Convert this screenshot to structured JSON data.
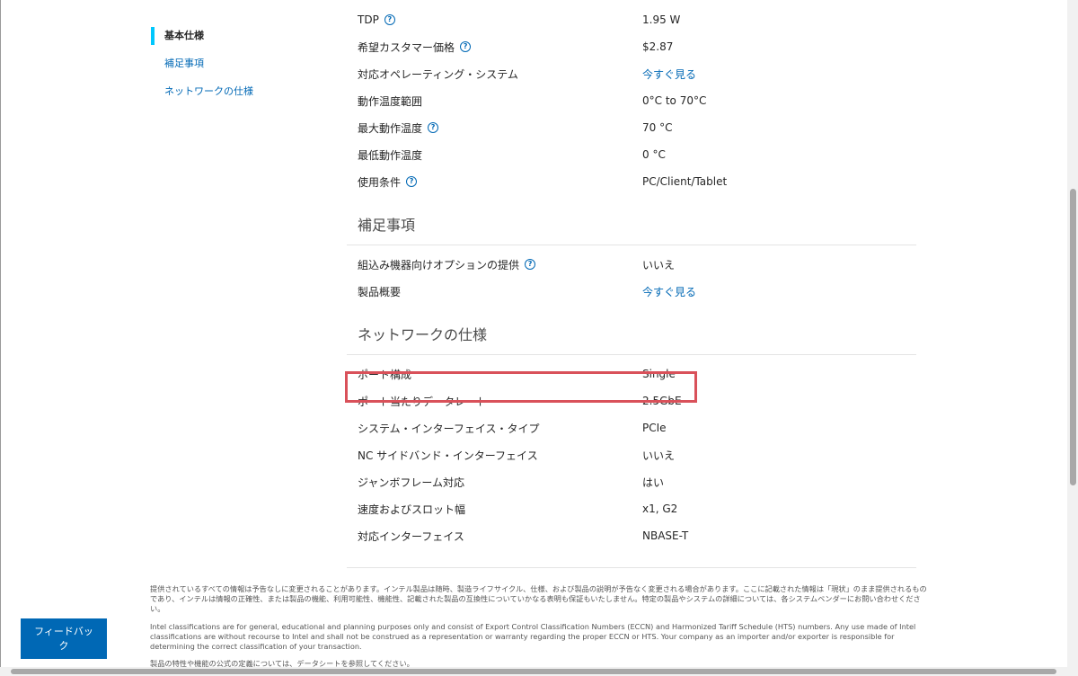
{
  "nav": {
    "items": [
      {
        "label": "基本仕様",
        "active": true
      },
      {
        "label": "補足事項",
        "active": false
      },
      {
        "label": "ネットワークの仕様",
        "active": false
      }
    ]
  },
  "essentials": {
    "rows": [
      {
        "label": "TDP",
        "value": "1.95 W",
        "help": true,
        "link": false
      },
      {
        "label": "希望カスタマー価格",
        "value": "$2.87",
        "help": true,
        "link": false
      },
      {
        "label": "対応オペレーティング・システム",
        "value": "今すぐ見る",
        "help": false,
        "link": true
      },
      {
        "label": "動作温度範囲",
        "value": "0°C to 70°C",
        "help": false,
        "link": false
      },
      {
        "label": "最大動作温度",
        "value": "70 °C",
        "help": true,
        "link": false
      },
      {
        "label": "最低動作温度",
        "value": "0 °C",
        "help": false,
        "link": false
      },
      {
        "label": "使用条件",
        "value": "PC/Client/Tablet",
        "help": true,
        "link": false
      }
    ]
  },
  "supplemental": {
    "title": "補足事項",
    "rows": [
      {
        "label": "組込み機器向けオプションの提供",
        "value": "いいえ",
        "help": true,
        "link": false
      },
      {
        "label": "製品概要",
        "value": "今すぐ見る",
        "help": false,
        "link": true
      }
    ]
  },
  "network": {
    "title": "ネットワークの仕様",
    "rows": [
      {
        "label": "ポート構成",
        "value": "Single",
        "help": false,
        "link": false
      },
      {
        "label": "ポート当たりデータレート",
        "value": "2.5GbE",
        "help": false,
        "link": false
      },
      {
        "label": "システム・インターフェイス・タイプ",
        "value": "PCIe",
        "help": false,
        "link": false
      },
      {
        "label": "NC サイドバンド・インターフェイス",
        "value": "いいえ",
        "help": false,
        "link": false
      },
      {
        "label": "ジャンボフレーム対応",
        "value": "はい",
        "help": false,
        "link": false
      },
      {
        "label": "速度およびスロット幅",
        "value": "x1, G2",
        "help": false,
        "link": false
      },
      {
        "label": "対応インターフェイス",
        "value": "NBASE-T",
        "help": false,
        "link": false
      }
    ]
  },
  "help_glyph": "?",
  "footer": {
    "disclaimer_jp": "提供されているすべての情報は予告なしに変更されることがあります。インテル製品は随時、製造ライフサイクル、仕様、および製品の説明が予告なく変更される場合があります。ここに記載された情報は「現状」のまま提供されるものであり、インテルは情報の正確性、または製品の機能、利用可能性、機能性、記載された製品の互換性についていかなる表明も保証もいたしません。特定の製品やシステムの詳細については、各システムベンダーにお問い合わせください。",
    "disclaimer_en": "Intel classifications are for general, educational and planning purposes only and consist of Export Control Classification Numbers (ECCN) and Harmonized Tariff Schedule (HTS) numbers. Any use made of Intel classifications are without recourse to Intel and shall not be construed as a representation or warranty regarding the proper ECCN or HTS. Your company as an importer and/or exporter is responsible for determining the correct classification of your transaction.",
    "disclaimer_partial": "製品の特性や機能の公式の定義については、データシートを参照してください。"
  },
  "feedback_button": "フィードバック",
  "colors": {
    "link": "#0068b5",
    "active_bar": "#00c7fd",
    "highlight_box": "#d9515a"
  }
}
